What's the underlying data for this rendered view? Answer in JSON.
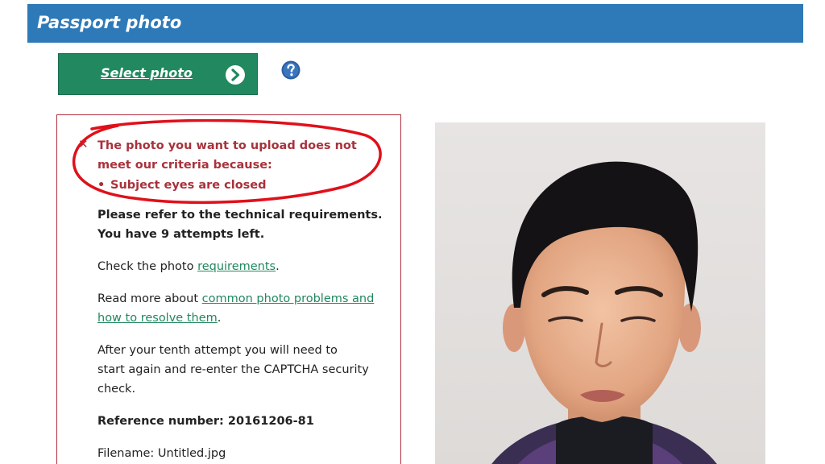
{
  "header": {
    "title": "Passport photo"
  },
  "select_button": {
    "label": "Select photo",
    "icon": "chevron-right-circle-icon"
  },
  "help": {
    "icon": "question-circle-icon"
  },
  "error": {
    "icon": "close-icon",
    "message": "The photo you want to upload does not meet our criteria because:",
    "reasons": [
      "Subject eyes are closed"
    ]
  },
  "info": {
    "line1": "Please refer to the technical requirements.",
    "line2": "You have 9 attempts left.",
    "check_prefix": "Check the photo ",
    "check_link": "requirements",
    "check_suffix": ".",
    "read_prefix": "Read more about ",
    "read_link1": "common photo problems and",
    "read_link2": "how to resolve them",
    "read_suffix": ".",
    "attempt_line1": "After your tenth attempt you will need to",
    "attempt_line2": "start again and re-enter the CAPTCHA security",
    "attempt_line3": "check.",
    "reference_label": "Reference number: ",
    "reference_value": "20161206-81",
    "filename_label": "Filename: ",
    "filename_value": "Untitled.jpg"
  },
  "colors": {
    "header_bg": "#2e7ab8",
    "button_bg": "#21885f",
    "error_text": "#a8323c",
    "annotation_red": "#e0101a",
    "link": "#21885f"
  }
}
